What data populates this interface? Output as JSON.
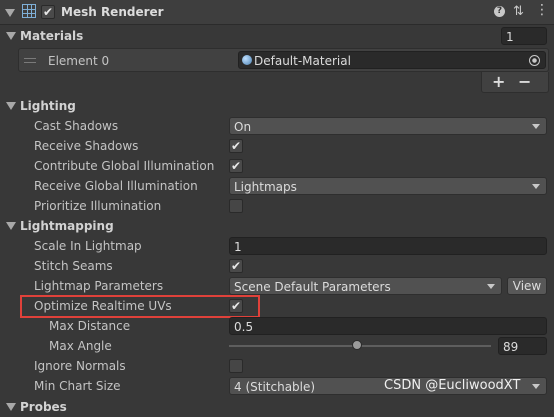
{
  "component": {
    "title": "Mesh Renderer",
    "enabled": true
  },
  "materials": {
    "label": "Materials",
    "count": "1",
    "element_label": "Element 0",
    "element_value": "Default-Material",
    "add": "+",
    "remove": "−"
  },
  "lighting": {
    "label": "Lighting",
    "cast_shadows": {
      "label": "Cast Shadows",
      "value": "On"
    },
    "receive_shadows": {
      "label": "Receive Shadows",
      "checked": true
    },
    "contribute_gi": {
      "label": "Contribute Global Illumination",
      "checked": true
    },
    "receive_gi": {
      "label": "Receive Global Illumination",
      "value": "Lightmaps"
    },
    "prioritize": {
      "label": "Prioritize Illumination",
      "checked": false
    }
  },
  "lightmapping": {
    "label": "Lightmapping",
    "scale": {
      "label": "Scale In Lightmap",
      "value": "1"
    },
    "stitch": {
      "label": "Stitch Seams",
      "checked": true
    },
    "params": {
      "label": "Lightmap Parameters",
      "value": "Scene Default Parameters",
      "view": "View"
    },
    "optimize": {
      "label": "Optimize Realtime UVs",
      "checked": true
    },
    "max_distance": {
      "label": "Max Distance",
      "value": "0.5"
    },
    "max_angle": {
      "label": "Max Angle",
      "value": "89",
      "slider_fraction": 0.49
    },
    "ignore_normals": {
      "label": "Ignore Normals",
      "checked": false
    },
    "min_chart": {
      "label": "Min Chart Size",
      "value": "4 (Stitchable)"
    }
  },
  "next_section": {
    "label": "Probes"
  },
  "watermark": "CSDN @EucliwoodXT",
  "colors": {
    "highlight": "#e0413a",
    "background": "#383838"
  }
}
